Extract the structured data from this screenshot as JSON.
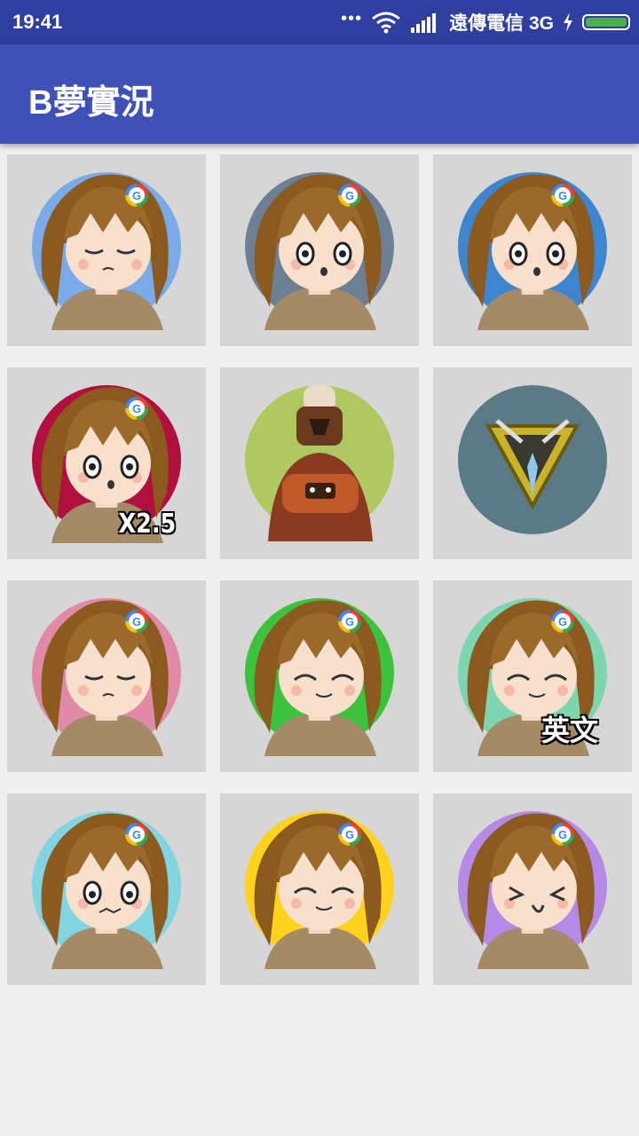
{
  "status_bar": {
    "time": "19:41",
    "dots": "•••",
    "carrier": "遠傳電信 3G",
    "battery_level": 1.0,
    "battery_color": "#4caf50"
  },
  "app_bar": {
    "title": "B夢實況"
  },
  "colors": {
    "status_bar": "#303f9f",
    "app_bar": "#3f51b5",
    "tile": "#d6d6d6",
    "background": "#efefef"
  },
  "tiles": [
    {
      "name": "avatar-angry-blue",
      "bg": "#7aaae8"
    },
    {
      "name": "avatar-shocked-grey",
      "bg": "#6d7f92"
    },
    {
      "name": "avatar-surprised-blue",
      "bg": "#3d86cf"
    },
    {
      "name": "avatar-surprised-crimson",
      "bg": "#b01040",
      "badge": "X2.5"
    },
    {
      "name": "avatar-chef-warrior",
      "bg": "#b0c860"
    },
    {
      "name": "avatar-triangle-emblem",
      "bg": "#5a7b86"
    },
    {
      "name": "avatar-angry-pink",
      "bg": "#e08aa8"
    },
    {
      "name": "avatar-happy-green",
      "bg": "#3cc23c"
    },
    {
      "name": "avatar-happy-mint",
      "bg": "#7ed6b0",
      "badge": "英文"
    },
    {
      "name": "avatar-grumpy-cyan",
      "bg": "#82d4e0"
    },
    {
      "name": "avatar-sparkle-yellow",
      "bg": "#ffd21e"
    },
    {
      "name": "avatar-laughing-purple",
      "bg": "#b48ae6"
    }
  ]
}
